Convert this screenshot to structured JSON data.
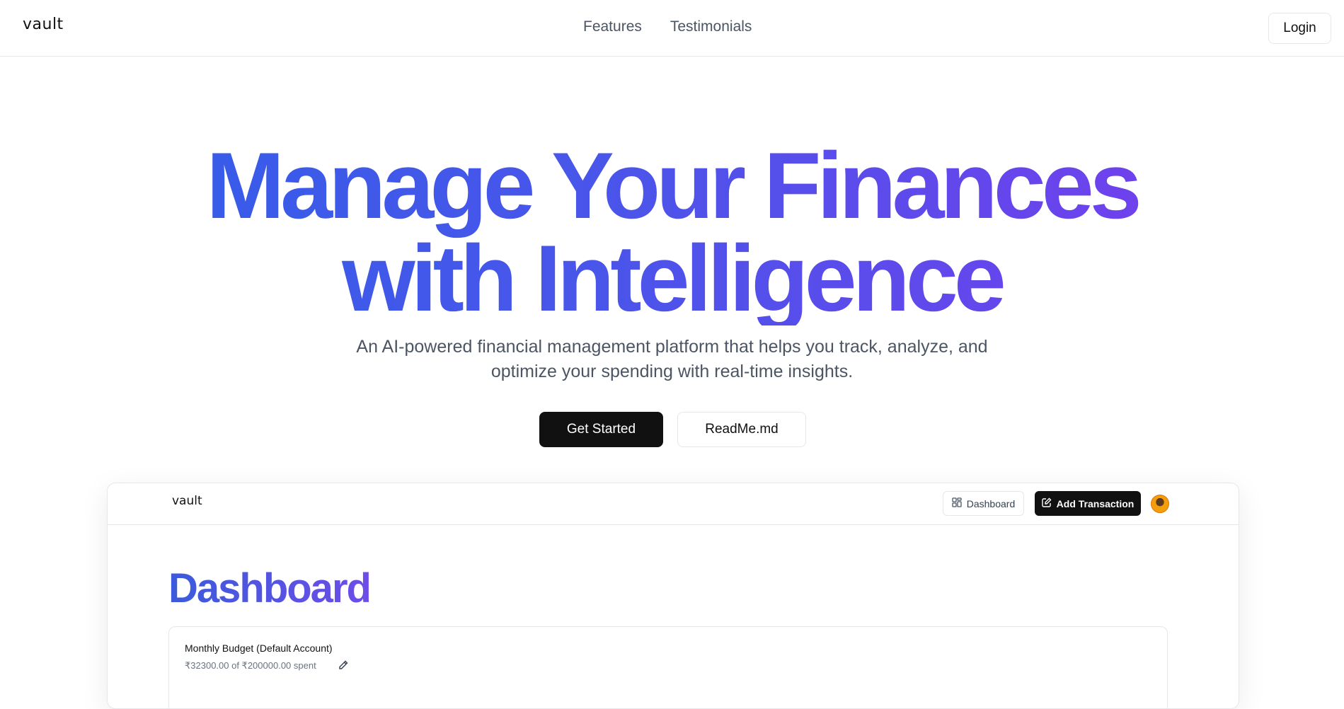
{
  "navbar": {
    "brand": "vault",
    "links": [
      "Features",
      "Testimonials"
    ],
    "login_label": "Login"
  },
  "hero": {
    "title_line1": "Manage Your Finances",
    "title_line2": "with Intelligence",
    "subtitle": "An AI-powered financial management platform that helps you track, analyze, and optimize your spending with real-time insights.",
    "primary_cta": "Get Started",
    "secondary_cta": "ReadMe.md"
  },
  "preview": {
    "brand": "vault",
    "dashboard_button": "Dashboard",
    "add_transaction_button": "Add Transaction",
    "heading": "Dashboard",
    "budget": {
      "title": "Monthly Budget (Default Account)",
      "spent": "₹32300.00 of ₹200000.00 spent"
    }
  },
  "colors": {
    "gradient_start": "#2f5fe8",
    "gradient_end": "#7c3aed",
    "primary_button": "#111111"
  }
}
